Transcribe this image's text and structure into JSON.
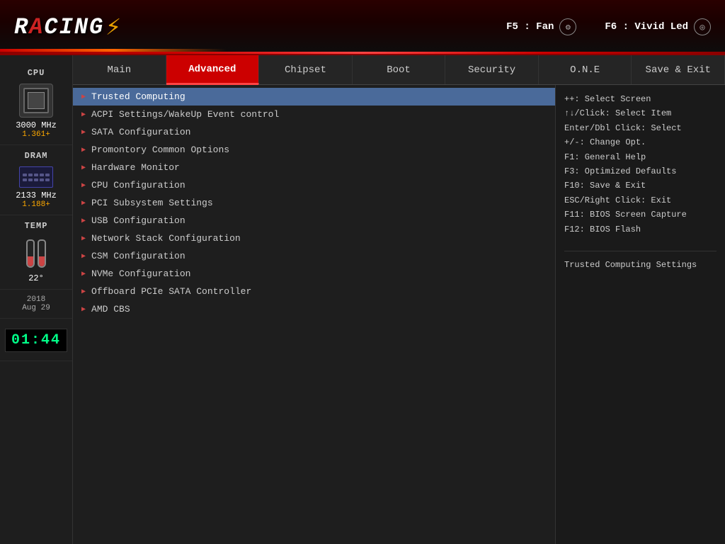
{
  "header": {
    "logo": "RACING",
    "logo_suffix": "✦",
    "fn5_label": "F5 : Fan",
    "fn6_label": "F6 : Vivid Led"
  },
  "sidebar": {
    "cpu_label": "CPU",
    "cpu_speed": "3000 MHz",
    "cpu_voltage": "1.361+",
    "dram_label": "DRAM",
    "dram_speed": "2133 MHz",
    "dram_voltage": "1.188+",
    "temp_label": "TEMP",
    "temp_value": "22°",
    "date_year": "2018",
    "date_day": "Aug 29",
    "clock": "01:44"
  },
  "nav": {
    "tabs": [
      {
        "id": "main",
        "label": "Main",
        "active": false
      },
      {
        "id": "advanced",
        "label": "Advanced",
        "active": true
      },
      {
        "id": "chipset",
        "label": "Chipset",
        "active": false
      },
      {
        "id": "boot",
        "label": "Boot",
        "active": false
      },
      {
        "id": "security",
        "label": "Security",
        "active": false
      },
      {
        "id": "one",
        "label": "O.N.E",
        "active": false
      },
      {
        "id": "save-exit",
        "label": "Save & Exit",
        "active": false
      }
    ]
  },
  "menu": {
    "items": [
      {
        "id": "trusted-computing",
        "label": "Trusted Computing",
        "selected": true
      },
      {
        "id": "acpi-settings",
        "label": "ACPI Settings/WakeUp Event control",
        "selected": false
      },
      {
        "id": "sata-config",
        "label": "SATA Configuration",
        "selected": false
      },
      {
        "id": "promontory",
        "label": "Promontory Common Options",
        "selected": false
      },
      {
        "id": "hardware-monitor",
        "label": "Hardware Monitor",
        "selected": false
      },
      {
        "id": "cpu-config",
        "label": "CPU Configuration",
        "selected": false
      },
      {
        "id": "pci-subsystem",
        "label": "PCI Subsystem Settings",
        "selected": false
      },
      {
        "id": "usb-config",
        "label": "USB Configuration",
        "selected": false
      },
      {
        "id": "network-stack",
        "label": "Network Stack Configuration",
        "selected": false
      },
      {
        "id": "csm-config",
        "label": "CSM Configuration",
        "selected": false
      },
      {
        "id": "nvme-config",
        "label": "NVMe Configuration",
        "selected": false
      },
      {
        "id": "offboard-pcie",
        "label": "Offboard PCIe SATA Controller",
        "selected": false
      },
      {
        "id": "amd-cbs",
        "label": "AMD CBS",
        "selected": false
      }
    ]
  },
  "help": {
    "keyboard_shortcuts": "++: Select Screen\n↑↓/Click: Select Item\nEnter/Dbl Click: Select\n+/-: Change Opt.\nF1: General Help\nF3: Optimized Defaults\nF10: Save & Exit\nESC/Right Click: Exit\nF11: BIOS Screen Capture\nF12: BIOS Flash",
    "description": "Trusted Computing\nSettings"
  }
}
